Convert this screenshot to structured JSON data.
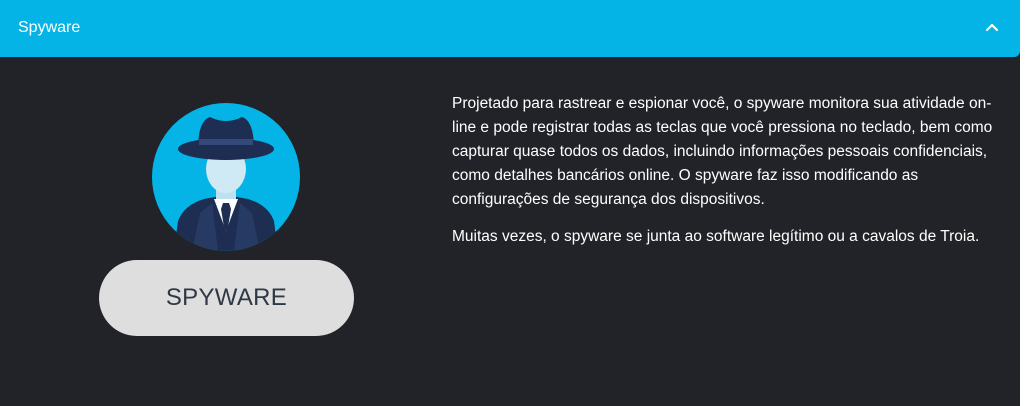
{
  "header": {
    "title": "Spyware",
    "toggle_icon": "chevron-up-icon"
  },
  "card": {
    "illustration": "spy-avatar-icon",
    "label": "SPYWARE"
  },
  "body": {
    "paragraphs": [
      "Projetado para rastrear e espionar você, o spyware monitora sua atividade on-line e pode registrar todas as teclas que você pressiona no teclado, bem como capturar quase todos os dados, incluindo informações pessoais confidenciais, como detalhes bancários online. O spyware faz isso modificando as configurações de segurança dos dispositivos.",
      "Muitas vezes, o spyware se junta ao software legítimo ou a cavalos de Troia."
    ]
  },
  "colors": {
    "header_bg": "#04b4e6",
    "panel_bg": "#222328",
    "avatar_circle": "#04b4e6",
    "spy_navy": "#1e2d52",
    "pill_bg": "#dedede"
  }
}
